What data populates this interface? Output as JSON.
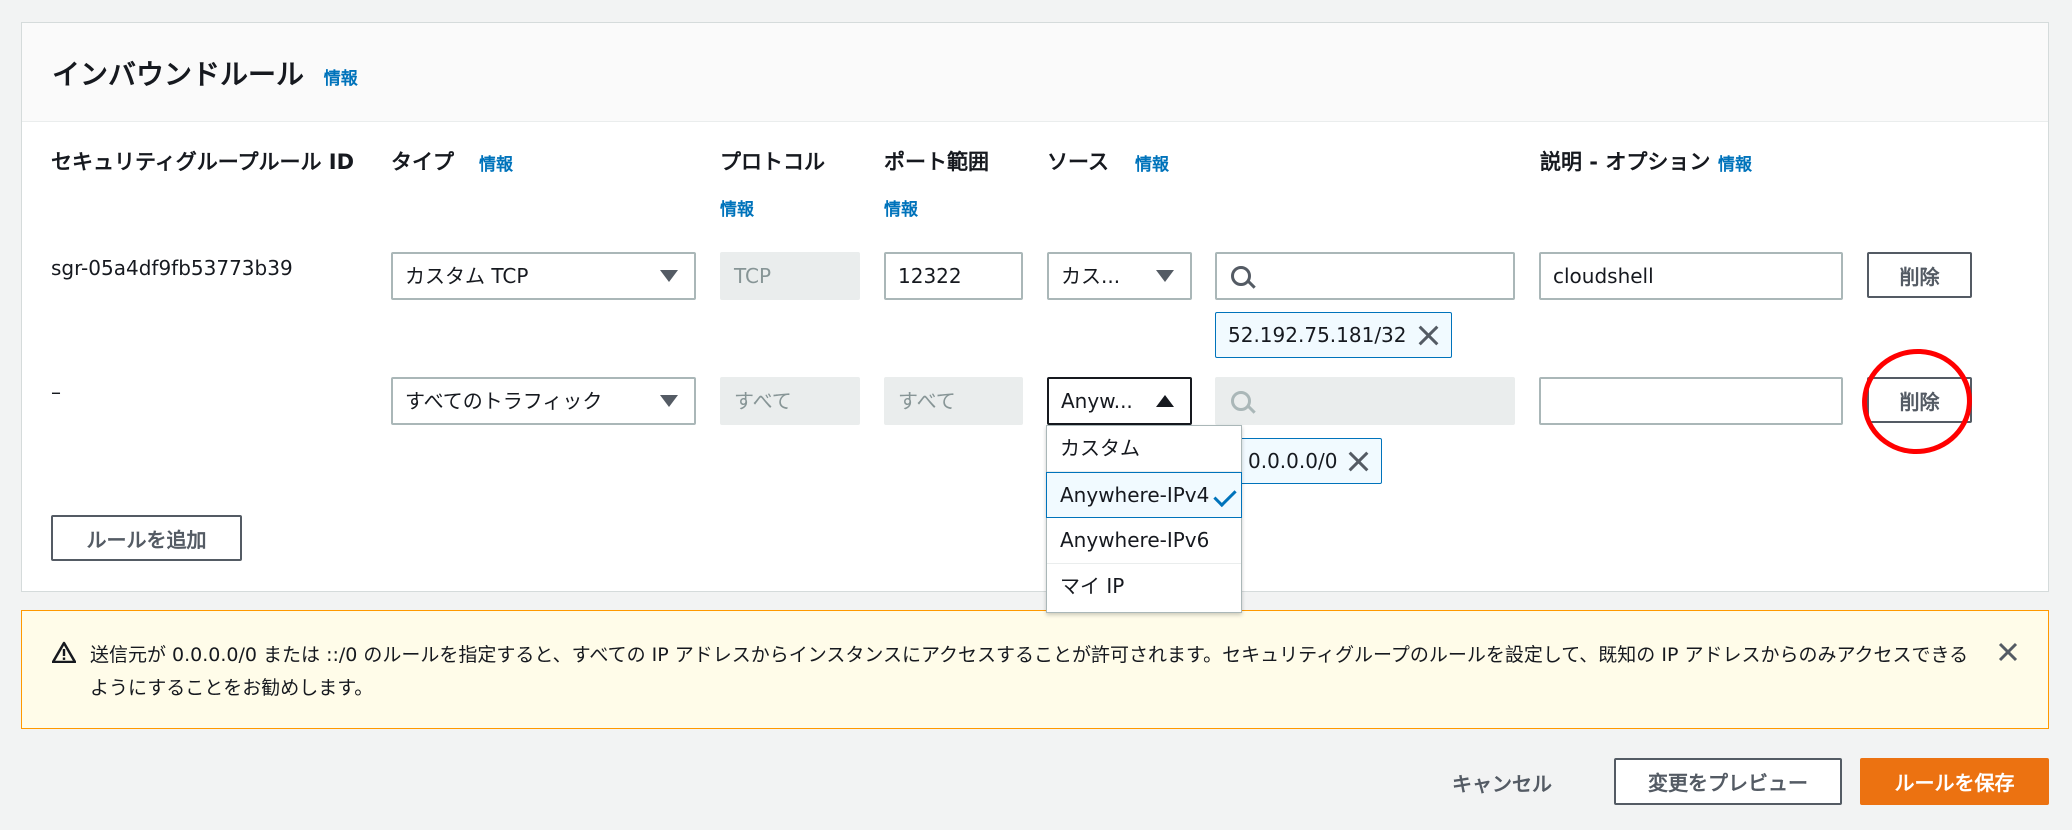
{
  "panel": {
    "title": "インバウンドルール",
    "info": "情報"
  },
  "columns": {
    "rule_id": "セキュリティグループルール ID",
    "type": "タイプ",
    "type_info": "情報",
    "protocol": "プロトコル",
    "protocol_info": "情報",
    "port_range": "ポート範囲",
    "port_info": "情報",
    "source": "ソース",
    "source_info": "情報",
    "description": "説明 - オプション",
    "description_info": "情報"
  },
  "rows": [
    {
      "rule_id": "sgr-05a4df9fb53773b39",
      "type": "カスタム TCP",
      "protocol": "TCP",
      "port": "12322",
      "source_kind": "カス...",
      "source_search": "",
      "cidr": "52.192.75.181/32",
      "description": "cloudshell",
      "delete": "削除"
    },
    {
      "rule_id": "–",
      "type": "すべてのトラフィック",
      "protocol": "すべて",
      "port": "すべて",
      "source_kind": "Anyw...",
      "source_search": "",
      "cidr": "0.0.0.0/0",
      "description": "",
      "delete": "削除"
    }
  ],
  "dropdown": {
    "options": [
      "カスタム",
      "Anywhere-IPv4",
      "Anywhere-IPv6",
      "マイ IP"
    ],
    "selected": "Anywhere-IPv4"
  },
  "add_rule": "ルールを追加",
  "warning": {
    "text": "送信元が 0.0.0.0/0 または ::/0 のルールを指定すると、すべての IP アドレスからインスタンスにアクセスすることが許可されます。セキュリティグループのルールを設定して、既知の IP アドレスからのみアクセスできるようにすることをお勧めします。"
  },
  "footer": {
    "cancel": "キャンセル",
    "preview": "変更をプレビュー",
    "save": "ルールを保存"
  },
  "colors": {
    "accent": "#0073bb",
    "primary": "#ec7211",
    "warning_border": "#ff9900",
    "annotation": "#ff0000"
  }
}
